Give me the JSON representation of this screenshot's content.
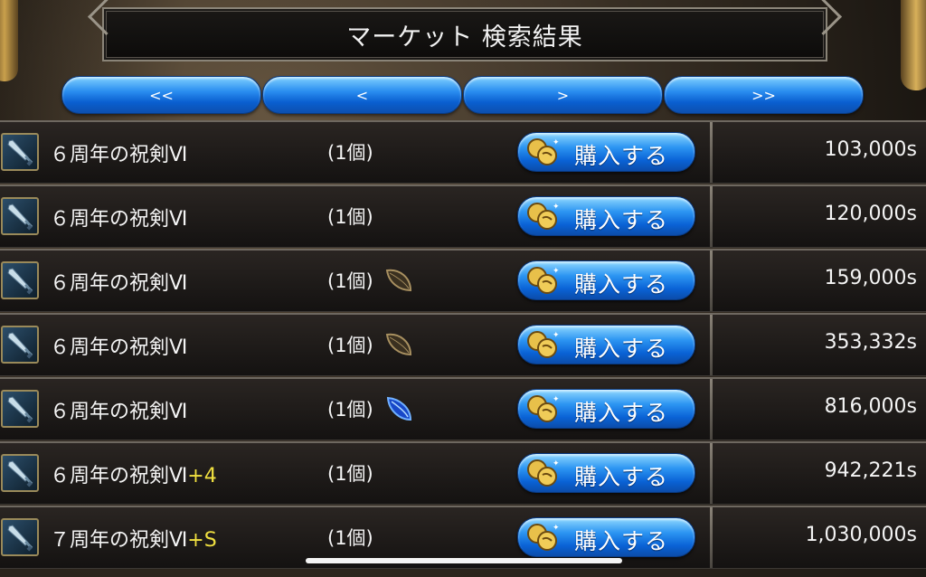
{
  "title": "マーケット 検索結果",
  "nav": {
    "first": "<<",
    "prev": "<",
    "next": ">",
    "last": ">>"
  },
  "buy_label": "購入する",
  "colors": {
    "button_blue": "#1e7fe8",
    "plus_yellow": "#f0e040",
    "text_white": "#f4f4f4"
  },
  "listings": [
    {
      "name": "６周年の祝剣Ⅵ",
      "plus": "",
      "qty": "(1個)",
      "attr": "",
      "price": "103,000s"
    },
    {
      "name": "６周年の祝剣Ⅵ",
      "plus": "",
      "qty": "(1個)",
      "attr": "",
      "price": "120,000s"
    },
    {
      "name": "６周年の祝剣Ⅵ",
      "plus": "",
      "qty": "(1個)",
      "attr": "earth-leaf-icon",
      "price": "159,000s"
    },
    {
      "name": "６周年の祝剣Ⅵ",
      "plus": "",
      "qty": "(1個)",
      "attr": "earth-leaf-icon",
      "price": "353,332s"
    },
    {
      "name": "６周年の祝剣Ⅵ",
      "plus": "",
      "qty": "(1個)",
      "attr": "water-drop-icon",
      "price": "816,000s"
    },
    {
      "name": "６周年の祝剣Ⅵ",
      "plus": "+4",
      "qty": "(1個)",
      "attr": "",
      "price": "942,221s"
    },
    {
      "name": "７周年の祝剣Ⅵ",
      "plus": "+S",
      "qty": "(1個)",
      "attr": "",
      "price": "1,030,000s"
    }
  ]
}
